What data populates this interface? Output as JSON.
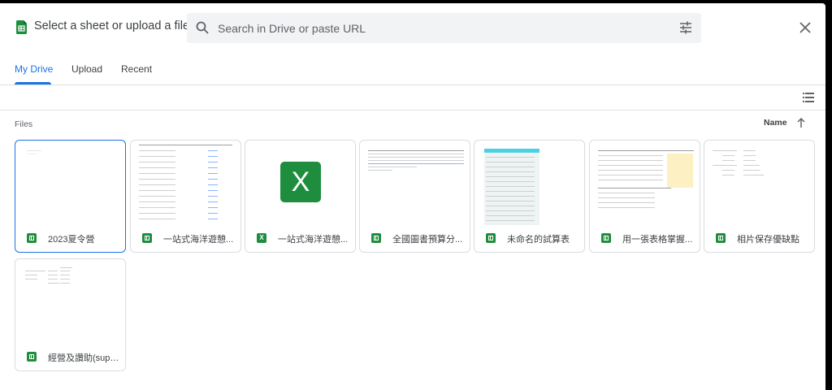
{
  "header": {
    "title": "Select a sheet or upload a file",
    "search_placeholder": "Search in Drive or paste URL"
  },
  "tabs": [
    {
      "label": "My Drive",
      "active": true
    },
    {
      "label": "Upload",
      "active": false
    },
    {
      "label": "Recent",
      "active": false
    }
  ],
  "section": {
    "label": "Files",
    "sort_label": "Name"
  },
  "files": [
    {
      "name": "2023夏令營",
      "type": "sheets",
      "selected": true
    },
    {
      "name": "一站式海洋遊憩...",
      "type": "sheets",
      "selected": false
    },
    {
      "name": "一站式海洋遊憩...",
      "type": "excel",
      "selected": false
    },
    {
      "name": "全國圖書預算分...",
      "type": "sheets",
      "selected": false
    },
    {
      "name": "未命名的試算表",
      "type": "sheets",
      "selected": false
    },
    {
      "name": "用一張表格掌握...",
      "type": "sheets",
      "selected": false
    },
    {
      "name": "相片保存優缺點",
      "type": "sheets",
      "selected": false
    },
    {
      "name": "經營及讚助(supp...",
      "type": "sheets",
      "selected": false
    }
  ],
  "colors": {
    "accent": "#1a73e8",
    "sheets_green": "#1e8e3e",
    "border": "#dadce0"
  },
  "icons": [
    "sheets-app-icon",
    "search-icon",
    "tune-icon",
    "close-icon",
    "list-view-icon",
    "arrow-up-icon",
    "sheets-file-icon",
    "excel-file-icon"
  ]
}
